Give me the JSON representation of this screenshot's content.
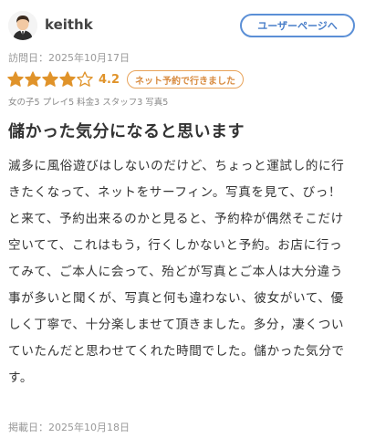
{
  "reviewer": {
    "name": "keithk",
    "user_page_button": "ユーザーページへ"
  },
  "visit_date": "訪問日：2025年10月17日",
  "rating": {
    "stars_filled": 4,
    "stars_total": 5,
    "score": "4.2",
    "badge": "ネット予約で行きました",
    "star_color": "#e0932a"
  },
  "subscores": "女の子5 プレイ5 料金3 スタッフ3 写真5",
  "review": {
    "title": "儲かった気分になると思います",
    "body": "滅多に風俗遊びはしないのだけど、ちょっと運試し的に行きたくなって、ネットをサーフィン。写真を見て、びっ！と来て、予約出来るのかと見ると、予約枠が偶然そこだけ空いてて、これはもう，行くしかないと予約。お店に行ってみて、ご本人に会って、殆どが写真とご本人は大分違う事が多いと聞くが、写真と何も違わない、彼女がいて、優しく丁寧で、十分楽しませて頂きました。多分，凄くついていたんだと思わせてくれた時間でした。儲かった気分です。"
  },
  "post_date": "掲載日：2025年10月18日",
  "colors": {
    "accent_blue": "#5b8fd6",
    "accent_orange": "#e8a35a"
  }
}
